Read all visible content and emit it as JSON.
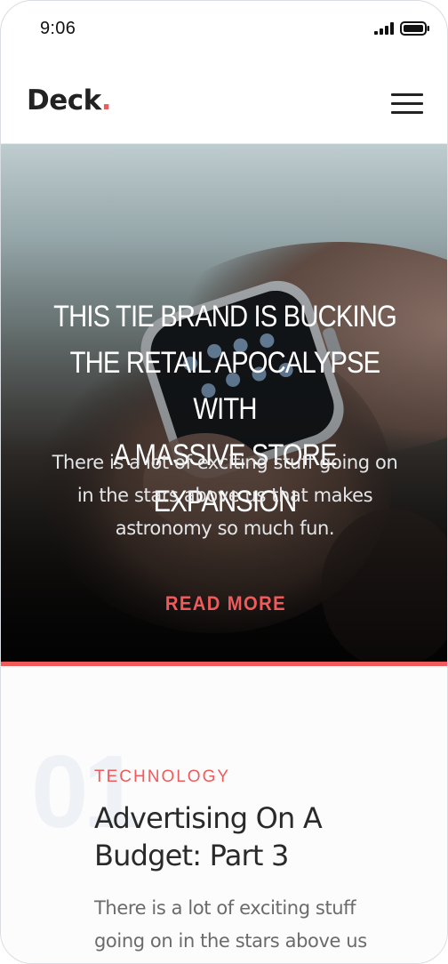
{
  "status_bar": {
    "time": "9:06",
    "signal_icon": "signal-bars-icon",
    "battery_icon": "battery-icon"
  },
  "header": {
    "logo_text": "Deck",
    "logo_dot": ".",
    "menu_icon": "hamburger-menu-icon"
  },
  "hero": {
    "background_image": "smartwatch-on-wrist-photo",
    "title": "This tie brand is bucking\nthe retail apocalypse with\na massive store expansion",
    "text": "There is a lot of exciting stuff going on in the stars above us that makes astronomy so much fun.",
    "read_more": "READ MORE"
  },
  "articles": [
    {
      "number": "01",
      "category": "TECHNOLOGY",
      "title": "Advertising On A Budget: Part 3",
      "excerpt": "There is a lot of exciting stuff going on in the stars above us"
    }
  ],
  "colors": {
    "accent": "#f15a5a",
    "text_dark": "#222222",
    "text_muted": "#6b6b6b",
    "number_faint": "#eef1f5"
  }
}
